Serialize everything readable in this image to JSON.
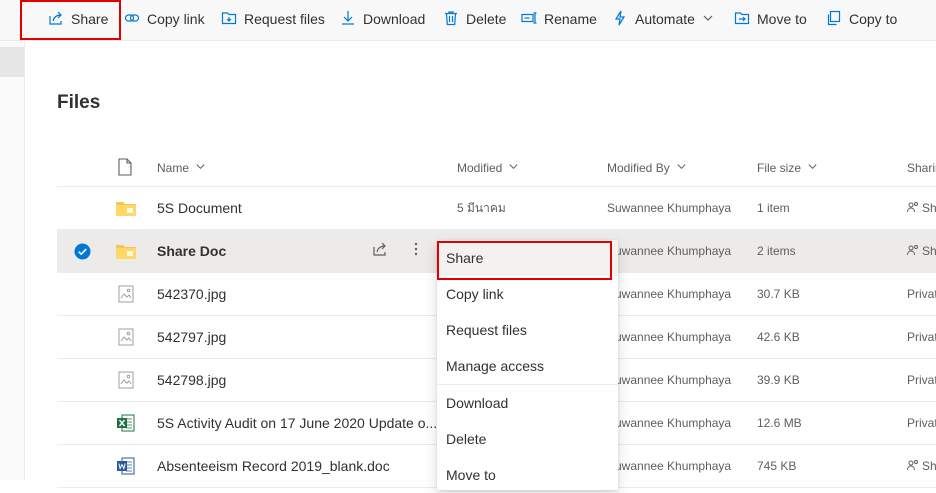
{
  "toolbar": {
    "share": "Share",
    "copy_link": "Copy link",
    "request_files": "Request files",
    "download": "Download",
    "delete": "Delete",
    "rename": "Rename",
    "automate": "Automate",
    "move_to": "Move to",
    "copy_to": "Copy to"
  },
  "page_title": "Files",
  "columns": {
    "name": "Name",
    "modified": "Modified",
    "modified_by": "Modified By",
    "file_size": "File size",
    "sharing": "Sharing"
  },
  "rows": [
    {
      "type": "folder",
      "name": "5S Document",
      "modified": "5 มีนาคม",
      "modified_by": "Suwannee Khumphaya",
      "size": "1 item",
      "sharing": "Sh",
      "shared_icon": true,
      "selected": false
    },
    {
      "type": "folder",
      "name": "Share Doc",
      "modified": "",
      "modified_by": "Suwannee Khumphaya",
      "size": "2 items",
      "sharing": "Sh",
      "shared_icon": true,
      "selected": true
    },
    {
      "type": "image",
      "name": "542370.jpg",
      "modified": "",
      "modified_by": "Suwannee Khumphaya",
      "size": "30.7 KB",
      "sharing": "Privat",
      "shared_icon": false,
      "selected": false
    },
    {
      "type": "image",
      "name": "542797.jpg",
      "modified": "",
      "modified_by": "Suwannee Khumphaya",
      "size": "42.6 KB",
      "sharing": "Privat",
      "shared_icon": false,
      "selected": false
    },
    {
      "type": "image",
      "name": "542798.jpg",
      "modified": "",
      "modified_by": "Suwannee Khumphaya",
      "size": "39.9 KB",
      "sharing": "Privat",
      "shared_icon": false,
      "selected": false
    },
    {
      "type": "excel",
      "name": "5S Activity Audit on 17 June 2020 Update o...",
      "modified": "",
      "modified_by": "Suwannee Khumphaya",
      "size": "12.6 MB",
      "sharing": "Privat",
      "shared_icon": false,
      "selected": false
    },
    {
      "type": "word",
      "name": "Absenteeism Record 2019_blank.doc",
      "modified": "",
      "modified_by": "Suwannee Khumphaya",
      "size": "745 KB",
      "sharing": "Sh",
      "shared_icon": true,
      "selected": false
    }
  ],
  "context_menu": [
    {
      "label": "Share"
    },
    {
      "label": "Copy link"
    },
    {
      "label": "Request files"
    },
    {
      "label": "Manage access"
    },
    {
      "label": "Download"
    },
    {
      "label": "Delete"
    },
    {
      "label": "Move to"
    }
  ],
  "colors": {
    "accent": "#0078d4",
    "highlight_box": "#e00000",
    "folder": "#f5c451",
    "excel": "#1e7145",
    "word": "#2b579a"
  }
}
